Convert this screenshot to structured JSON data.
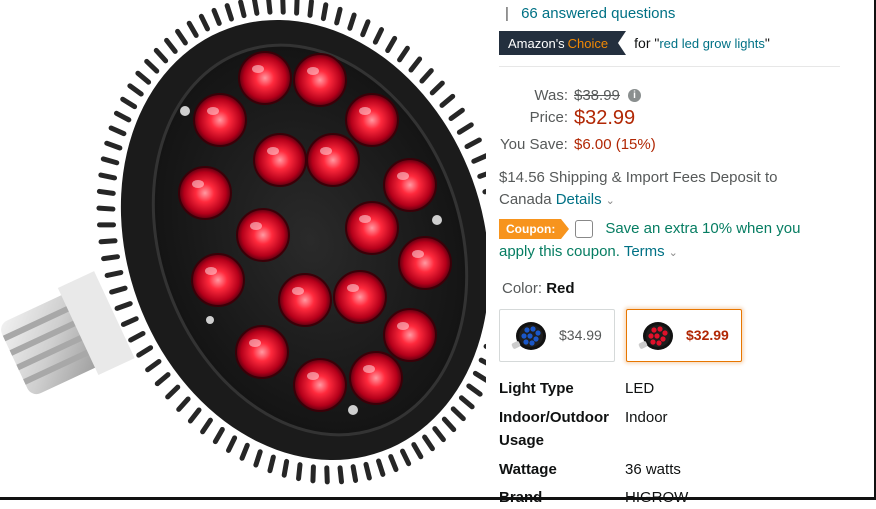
{
  "qa": {
    "separator": "|",
    "link": "66 answered questions"
  },
  "badge": {
    "brand": "Amazon's",
    "choice": "Choice",
    "for_text": "for \"",
    "keyword": "red led grow lights",
    "close_quote": "\""
  },
  "pricing": {
    "was_label": "Was:",
    "was_value": "$38.99",
    "info_icon": "i",
    "price_label": "Price:",
    "price_value": "$32.99",
    "save_label": "You Save:",
    "save_value": "$6.00 (15%)"
  },
  "shipping": {
    "text": "$14.56 Shipping & Import Fees Deposit to Canada",
    "details": "Details",
    "chevron": "⌄"
  },
  "coupon": {
    "tag": "Coupon:",
    "text": "Save an extra 10% when you apply this coupon.",
    "terms": "Terms",
    "chevron": "⌄"
  },
  "color": {
    "label": "Color:",
    "selected": "Red",
    "options": [
      {
        "price": "$34.99",
        "icon": "blue-led-bulb-thumbnail",
        "accent": "#1a57c8",
        "selected": false
      },
      {
        "price": "$32.99",
        "icon": "red-led-bulb-thumbnail",
        "accent": "#e0102a",
        "selected": true
      }
    ]
  },
  "specs": [
    {
      "label": "Light Type",
      "value": "LED"
    },
    {
      "label": "Indoor/Outdoor Usage",
      "value": "Indoor"
    },
    {
      "label": "Wattage",
      "value": "36 watts"
    },
    {
      "label": "Brand",
      "value": "HIGROW"
    }
  ],
  "colors": {
    "link": "#007185",
    "price": "#b12704",
    "coupon_green": "#067d62",
    "coupon_tag": "#f7941d",
    "choice_badge": "#232f3e",
    "choice_accent": "#f08804"
  }
}
